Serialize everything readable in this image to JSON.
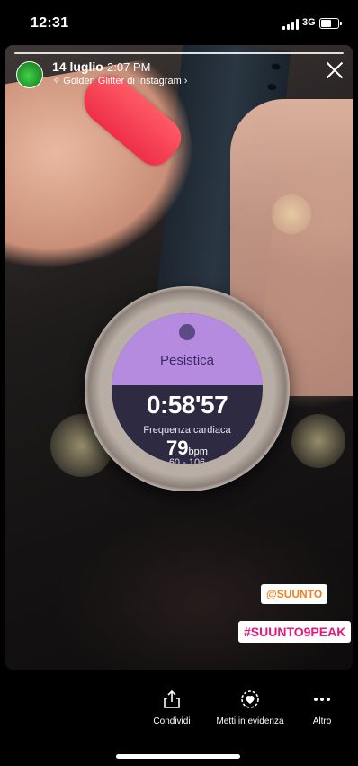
{
  "status_bar": {
    "time": "12:31",
    "network": "3G"
  },
  "story": {
    "date": "14 luglio",
    "time": "2:07 PM",
    "filter_label": "Golden Glitter di Instagram",
    "filter_chevron": "›",
    "watch": {
      "mode": "Pesistica",
      "elapsed": "0:58'57",
      "hr_label": "Frequenza cardiaca",
      "hr_value": "79",
      "hr_unit": "bpm",
      "hr_range": "60 - 106"
    },
    "stickers": {
      "mention": "@SUUNTO",
      "hashtag": "#SUUNTO9PEAK"
    }
  },
  "toolbar": {
    "share_label": "Condividi",
    "highlight_label": "Metti in evidenza",
    "more_label": "Altro"
  },
  "icons": {
    "close": "close-icon",
    "share": "share-icon",
    "highlight": "heart-highlight-icon",
    "more": "more-icon",
    "sparkle": "sparkle-icon"
  },
  "colors": {
    "mention": "#f07f1e",
    "hashtag": "#e2187c",
    "watch_accent": "#b58be0"
  }
}
